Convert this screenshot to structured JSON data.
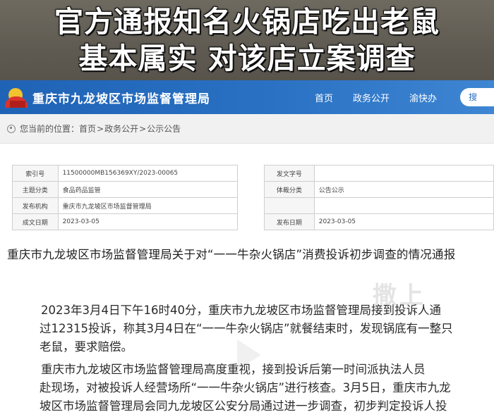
{
  "headline": {
    "line1": "官方通报知名火锅店吃出老鼠",
    "line2": "基本属实 对该店立案调查"
  },
  "site": {
    "title": "重庆市九龙坡区市场监督管理局",
    "nav": [
      "首页",
      "政务公开",
      "渝快办"
    ],
    "search_label": "搜"
  },
  "breadcrumb": {
    "prefix": "您当前的位置：",
    "items": [
      "首页",
      "政务公开",
      "公示公告"
    ],
    "separator": ">"
  },
  "meta": {
    "rows": [
      {
        "label1": "索引号",
        "value1": "11500000MB156369XY/2023-00065",
        "label2": "发文字号",
        "value2": ""
      },
      {
        "label1": "主题分类",
        "value1": "食品药品监管",
        "label2": "体裁分类",
        "value2": "公告公示"
      },
      {
        "label1": "发布机构",
        "value1": "重庆市九龙坡区市场监督管理局",
        "label2": "",
        "value2": ""
      },
      {
        "label1": "成文日期",
        "value1": "2023-03-05",
        "label2": "发布日期",
        "value2": "2023-03-05"
      }
    ]
  },
  "article": {
    "title": "重庆市九龙坡区市场监督管理局关于对“一一牛杂火锅店”消费投诉初步调查的情况通报",
    "watermark": "撒上",
    "paragraph1": [
      "2023年3月4日下午16时40分，重庆市九龙坡区市场监督管理局接到投诉人通",
      "过12315投诉，称其3月4日在“一一牛杂火锅店”就餐结束时，发现锅底有一整只",
      "老鼠，要求赔偿。"
    ],
    "paragraph2": [
      "重庆市九龙坡区市场监督管理局高度重视，接到投诉后第一时间派执法人员",
      "赴现场，对被投诉人经营场所“一一牛杂火锅店”进行核查。3月5日，重庆市九龙",
      "坡区市场监督管理局会同九龙坡区公安分局通过进一步调查，初步判定投诉人投"
    ]
  }
}
